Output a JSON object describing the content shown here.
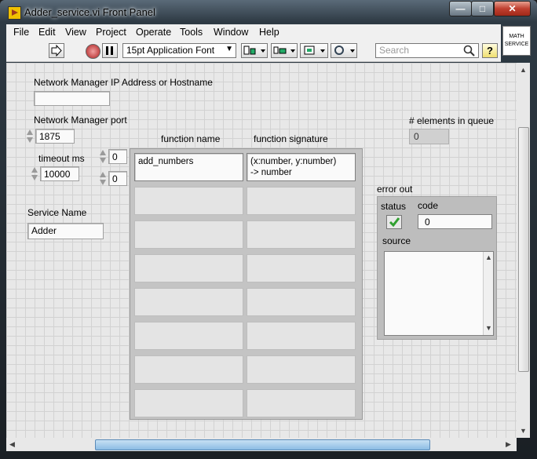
{
  "window": {
    "title": "Adder_service.vi Front Panel"
  },
  "caption": {
    "minimize": "—",
    "maximize": "□",
    "close": "✕"
  },
  "menu": [
    "File",
    "Edit",
    "View",
    "Project",
    "Operate",
    "Tools",
    "Window",
    "Help"
  ],
  "toolbar": {
    "font": "15pt Application Font",
    "search_placeholder": "Search",
    "help": "?"
  },
  "badge": {
    "line1": "MATH",
    "line2": "SERVICE"
  },
  "controls": {
    "nm_address_label": "Network Manager IP Address or Hostname",
    "nm_address_value": "",
    "nm_port_label": "Network Manager port",
    "nm_port_value": "1875",
    "timeout_label": "timeout ms",
    "timeout_value": "10000",
    "index_row": "0",
    "index_col": "0",
    "service_name_label": "Service Name",
    "service_name_value": "Adder",
    "elements_label": "# elements in queue",
    "elements_value": "0"
  },
  "table": {
    "col1_header": "function name",
    "col2_header": "function signature",
    "rows": [
      {
        "name": "add_numbers",
        "sig1": "(x:number, y:number)",
        "sig2": "-> number"
      }
    ]
  },
  "error_out": {
    "label": "error out",
    "status_label": "status",
    "code_label": "code",
    "code_value": "0",
    "source_label": "source",
    "source_value": ""
  },
  "colors": {
    "status_ok": "#30a030",
    "accent": "#3a7bc8"
  }
}
